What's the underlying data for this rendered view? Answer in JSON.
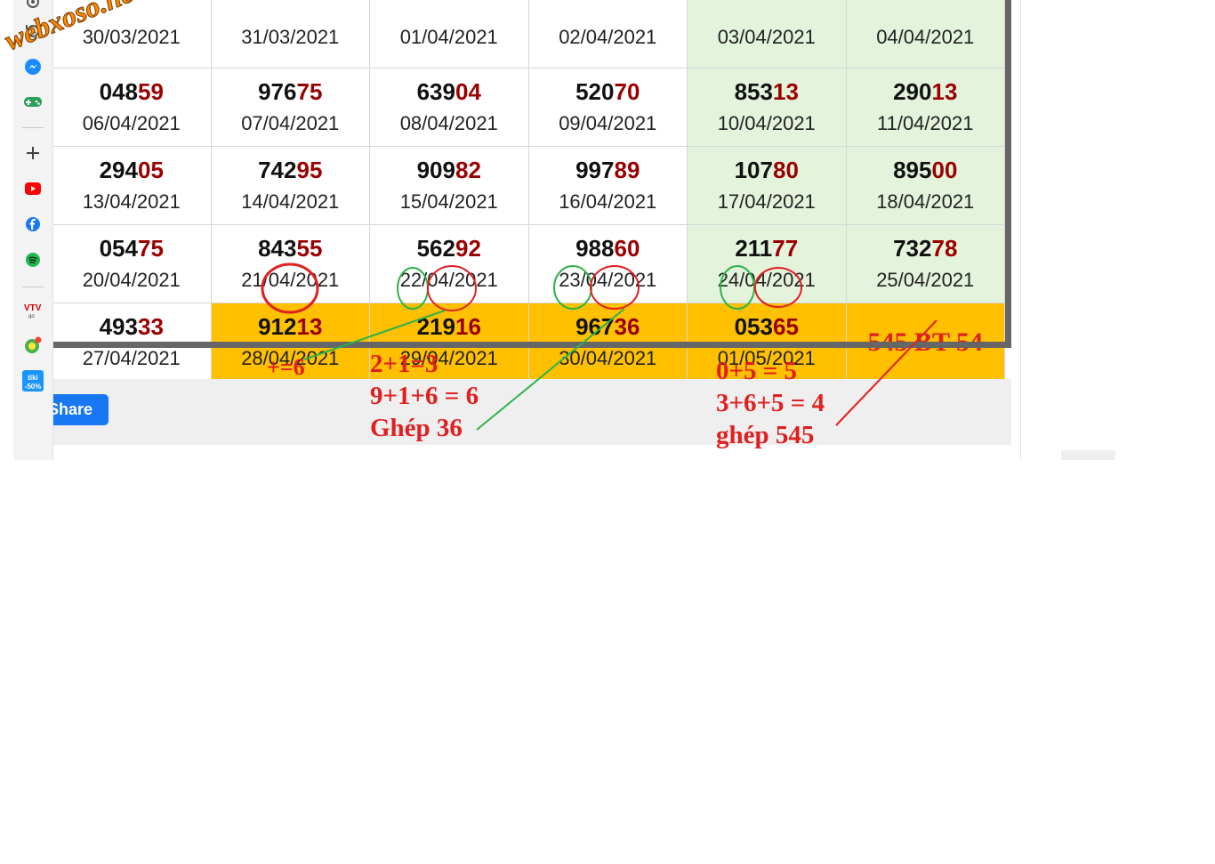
{
  "watermark": "webxoso.net",
  "table": {
    "rows": [
      [
        {
          "head": "",
          "tail": "",
          "date": "30/03/2021",
          "style": "plain"
        },
        {
          "head": "",
          "tail": "",
          "date": "31/03/2021",
          "style": "plain"
        },
        {
          "head": "",
          "tail": "",
          "date": "01/04/2021",
          "style": "plain"
        },
        {
          "head": "",
          "tail": "",
          "date": "02/04/2021",
          "style": "plain"
        },
        {
          "head": "",
          "tail": "",
          "date": "03/04/2021",
          "style": "weekend"
        },
        {
          "head": "",
          "tail": "",
          "date": "04/04/2021",
          "style": "weekend"
        }
      ],
      [
        {
          "head": "048",
          "tail": "59",
          "date": "06/04/2021",
          "style": "plain"
        },
        {
          "head": "976",
          "tail": "75",
          "date": "07/04/2021",
          "style": "plain"
        },
        {
          "head": "639",
          "tail": "04",
          "date": "08/04/2021",
          "style": "plain"
        },
        {
          "head": "520",
          "tail": "70",
          "date": "09/04/2021",
          "style": "plain"
        },
        {
          "head": "853",
          "tail": "13",
          "date": "10/04/2021",
          "style": "weekend"
        },
        {
          "head": "290",
          "tail": "13",
          "date": "11/04/2021",
          "style": "weekend"
        }
      ],
      [
        {
          "head": "294",
          "tail": "05",
          "date": "13/04/2021",
          "style": "plain"
        },
        {
          "head": "742",
          "tail": "95",
          "date": "14/04/2021",
          "style": "plain"
        },
        {
          "head": "909",
          "tail": "82",
          "date": "15/04/2021",
          "style": "plain"
        },
        {
          "head": "997",
          "tail": "89",
          "date": "16/04/2021",
          "style": "plain"
        },
        {
          "head": "107",
          "tail": "80",
          "date": "17/04/2021",
          "style": "weekend"
        },
        {
          "head": "895",
          "tail": "00",
          "date": "18/04/2021",
          "style": "weekend"
        }
      ],
      [
        {
          "head": "054",
          "tail": "75",
          "date": "20/04/2021",
          "style": "plain"
        },
        {
          "head": "843",
          "tail": "55",
          "date": "21/04/2021",
          "style": "plain"
        },
        {
          "head": "562",
          "tail": "92",
          "date": "22/04/2021",
          "style": "plain"
        },
        {
          "head": "988",
          "tail": "60",
          "date": "23/04/2021",
          "style": "plain"
        },
        {
          "head": "211",
          "tail": "77",
          "date": "24/04/2021",
          "style": "weekend"
        },
        {
          "head": "732",
          "tail": "78",
          "date": "25/04/2021",
          "style": "weekend"
        }
      ],
      [
        {
          "head": "493",
          "tail": "33",
          "date": "27/04/2021",
          "style": "plain"
        },
        {
          "head": "912",
          "tail": "13",
          "date": "28/04/2021",
          "style": "highlight"
        },
        {
          "head": "219",
          "tail": "16",
          "date": "29/04/2021",
          "style": "highlight"
        },
        {
          "head": "967",
          "tail": "36",
          "date": "30/04/2021",
          "style": "highlight"
        },
        {
          "head": "053",
          "tail": "65",
          "date": "01/05/2021",
          "style": "highlight"
        },
        {
          "head": "",
          "tail": "",
          "date": "",
          "note": "545 BT 54",
          "style": "highlight"
        }
      ]
    ]
  },
  "share_label": "Share",
  "annotations": {
    "a1": "+=6",
    "a2_l1": "2+1=3",
    "a2_l2": "9+1+6 = 6",
    "a2_l3": "Ghép 36",
    "a3_l1": "0+5 = 5",
    "a3_l2": "3+6+5 = 4",
    "a3_l3": "ghép 545"
  },
  "sidebar": {
    "icons": [
      "gear-icon",
      "history-icon",
      "messenger-icon",
      "games-icon",
      "add-icon",
      "youtube-icon",
      "facebook-icon",
      "spotify-icon",
      "vtv-go-icon",
      "maps-icon",
      "tiki-icon"
    ],
    "tiki_badge": "tiki",
    "tiki_discount": "-50%"
  },
  "colors": {
    "highlight": "#ffc000",
    "weekend": "#e3f3dc",
    "tail_digits": "#9a0000",
    "annotation_red": "#e02020",
    "circle_green": "#2db34a",
    "share_blue": "#1877f2"
  }
}
